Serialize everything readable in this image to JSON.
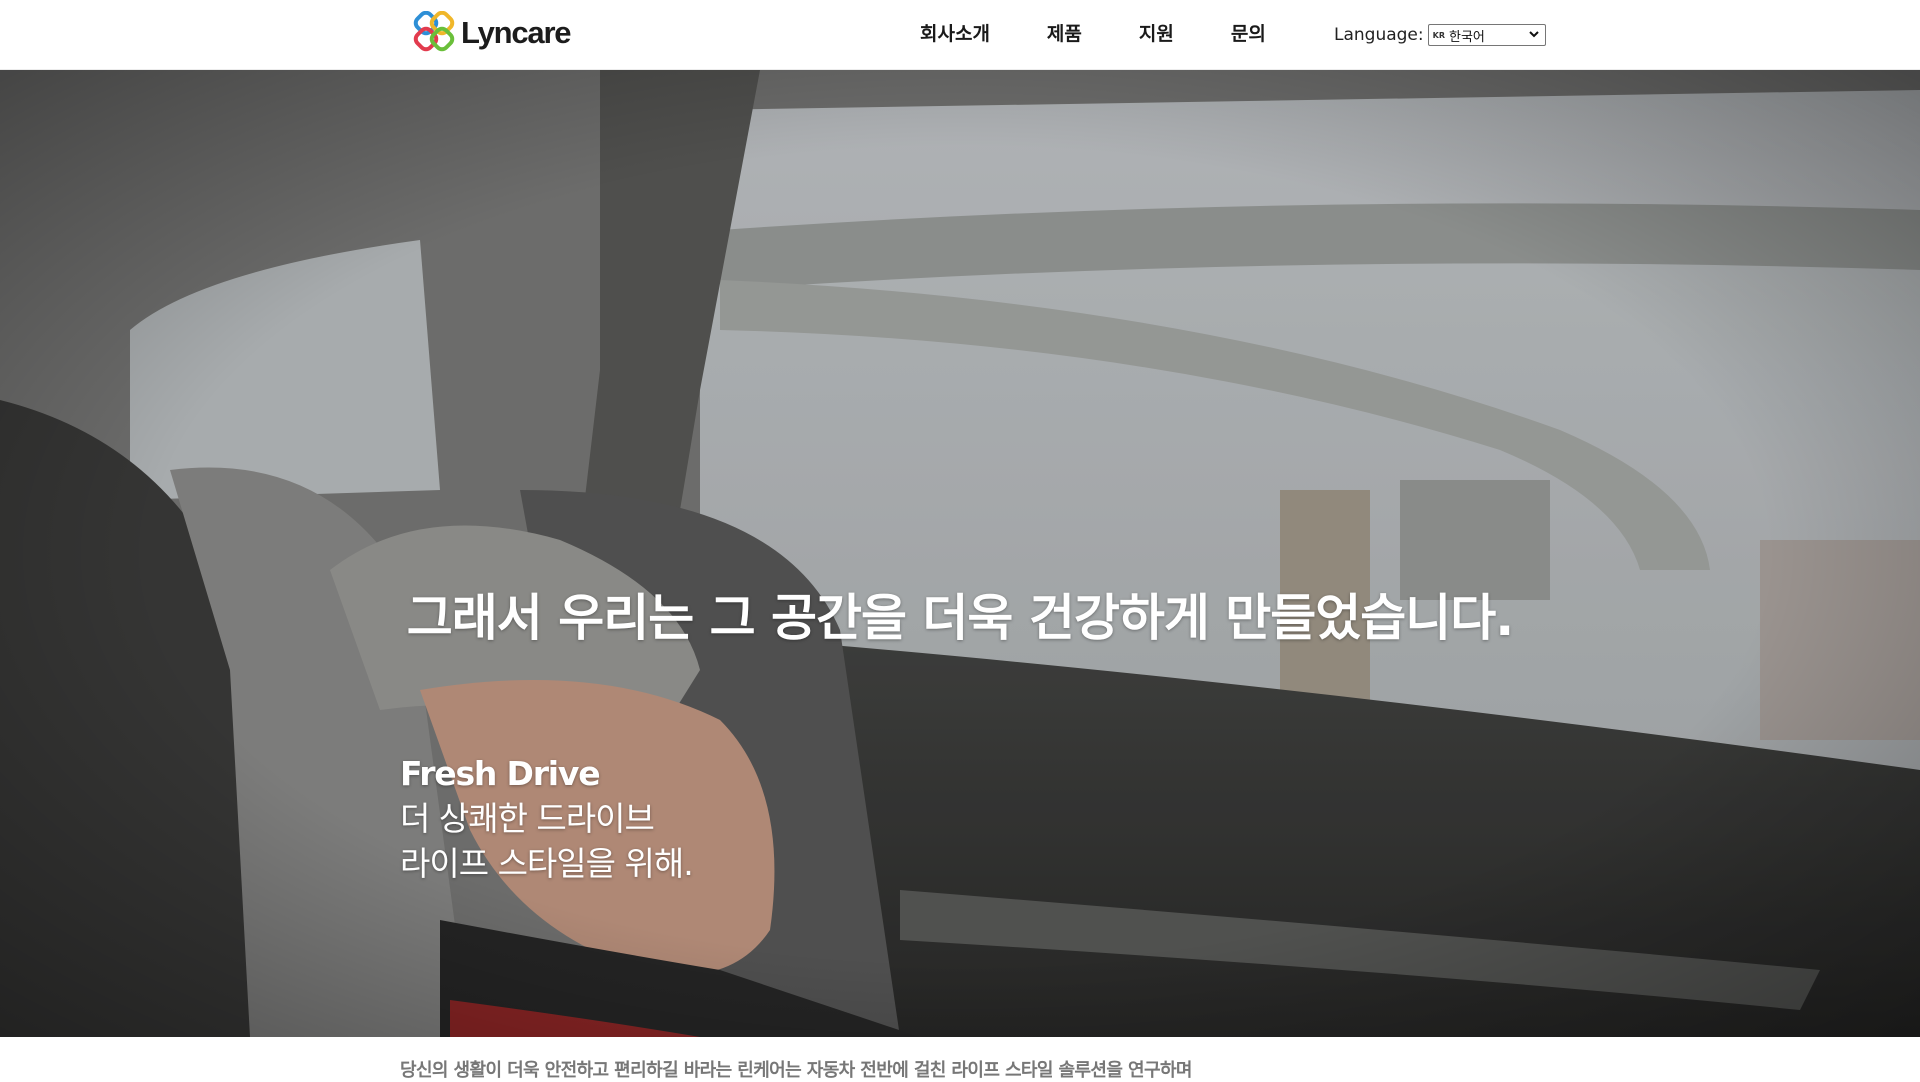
{
  "header": {
    "logo_text": "Lyncare",
    "nav": [
      {
        "label": "회사소개"
      },
      {
        "label": "제품"
      },
      {
        "label": "지원"
      },
      {
        "label": "문의"
      }
    ],
    "language_label": "Language:",
    "language_flag": "KR",
    "language_selected": "한국어"
  },
  "hero": {
    "tagline": "그래서 우리는 그 공간을 더욱 건강하게 만들었습니다.",
    "title": "Fresh Drive",
    "line1": "더 상쾌한 드라이브",
    "line2": "라이프 스타일을 위해."
  },
  "strip": {
    "text": "당신의 생활이 더욱 안전하고 편리하길 바라는 린케어는 자동차 전반에 걸친 라이프 스타일 솔루션을 연구하며"
  },
  "icons": {
    "logo": "lyncare-logo-icon",
    "select_arrow": "chevron-down-icon"
  }
}
